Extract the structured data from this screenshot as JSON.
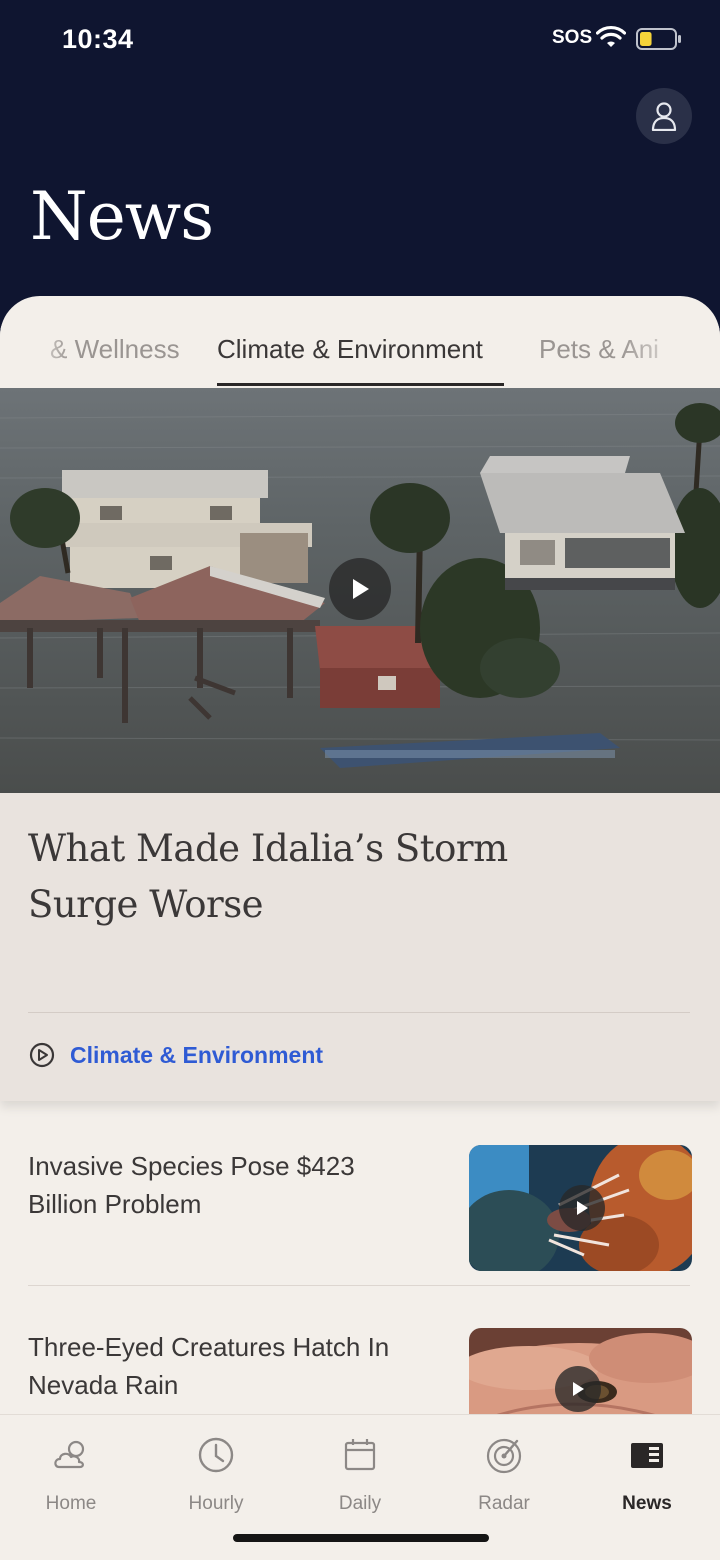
{
  "status_bar": {
    "time": "10:34",
    "sos": "SOS",
    "battery_level": 0.35,
    "battery_color": "#f5d33a"
  },
  "header": {
    "title": "News",
    "profile_icon": "person-icon"
  },
  "tabs": [
    {
      "label": "& Wellness",
      "active": false
    },
    {
      "label": "Climate & Environment",
      "active": true
    },
    {
      "label": "Pets & Ani",
      "active": false
    }
  ],
  "featured": {
    "title": "What Made Idalia’s Storm Surge Worse",
    "category_icon": "play-circle-icon",
    "category": "Climate & Environment",
    "has_video": true
  },
  "list": [
    {
      "title": "Invasive Species Pose $423 Billion Problem",
      "has_video": true
    },
    {
      "title": "Three-Eyed Creatures Hatch In Nevada Rain",
      "has_video": true
    }
  ],
  "tabbar": [
    {
      "label": "Home",
      "icon": "cloud-sun-icon",
      "active": false
    },
    {
      "label": "Hourly",
      "icon": "clock-icon",
      "active": false
    },
    {
      "label": "Daily",
      "icon": "calendar-icon",
      "active": false
    },
    {
      "label": "Radar",
      "icon": "radar-icon",
      "active": false
    },
    {
      "label": "News",
      "icon": "news-icon",
      "active": true
    }
  ],
  "colors": {
    "header_bg": "#0f1530",
    "sheet_bg": "#f3efea",
    "accent": "#2f5bd4"
  }
}
